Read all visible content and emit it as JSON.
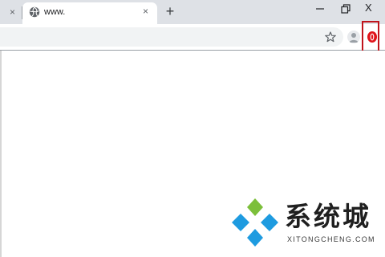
{
  "browser": {
    "tabs": [
      {
        "label": "",
        "close_glyph": "×"
      },
      {
        "label": "www.",
        "close_glyph": "×",
        "favicon": "globe-icon",
        "active": true
      }
    ],
    "new_tab_glyph": "+",
    "window_controls": {
      "minimize": "minimize-icon",
      "restore": "restore-icon",
      "close": "X"
    }
  },
  "toolbar": {
    "address_value": "",
    "bookmark_icon": "star-icon",
    "profile_icon": "avatar",
    "extension_icon": "red-extension-icon",
    "highlight_color": "#c0141c"
  },
  "watermark": {
    "name": "系统城",
    "url": "XITONGCHENG.COM",
    "colors": {
      "green": "#7cbf3a",
      "blue": "#1e9be0"
    }
  }
}
